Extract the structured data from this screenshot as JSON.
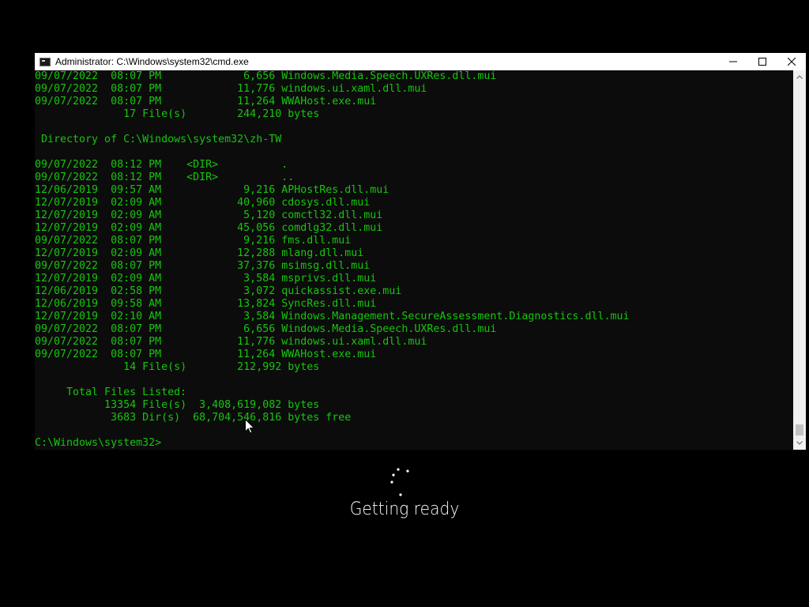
{
  "window": {
    "title": "Administrator: C:\\Windows\\system32\\cmd.exe",
    "controls": {
      "minimize": "minimize-icon",
      "maximize": "maximize-icon",
      "close": "close-icon"
    }
  },
  "console": {
    "lines": [
      "09/07/2022  08:07 PM             6,656 Windows.Media.Speech.UXRes.dll.mui",
      "09/07/2022  08:07 PM            11,776 windows.ui.xaml.dll.mui",
      "09/07/2022  08:07 PM            11,264 WWAHost.exe.mui",
      "              17 File(s)        244,210 bytes",
      "",
      " Directory of C:\\Windows\\system32\\zh-TW",
      "",
      "09/07/2022  08:12 PM    <DIR>          .",
      "09/07/2022  08:12 PM    <DIR>          ..",
      "12/06/2019  09:57 AM             9,216 APHostRes.dll.mui",
      "12/07/2019  02:09 AM            40,960 cdosys.dll.mui",
      "12/07/2019  02:09 AM             5,120 comctl32.dll.mui",
      "12/07/2019  02:09 AM            45,056 comdlg32.dll.mui",
      "09/07/2022  08:07 PM             9,216 fms.dll.mui",
      "12/07/2019  02:09 AM            12,288 mlang.dll.mui",
      "09/07/2022  08:07 PM            37,376 msimsg.dll.mui",
      "12/07/2019  02:09 AM             3,584 msprivs.dll.mui",
      "12/06/2019  02:58 PM             3,072 quickassist.exe.mui",
      "12/06/2019  09:58 AM            13,824 SyncRes.dll.mui",
      "12/07/2019  02:10 AM             3,584 Windows.Management.SecureAssessment.Diagnostics.dll.mui",
      "09/07/2022  08:07 PM             6,656 Windows.Media.Speech.UXRes.dll.mui",
      "09/07/2022  08:07 PM            11,776 windows.ui.xaml.dll.mui",
      "09/07/2022  08:07 PM            11,264 WWAHost.exe.mui",
      "              14 File(s)        212,992 bytes",
      "",
      "     Total Files Listed:",
      "           13354 File(s)  3,408,619,082 bytes",
      "            3683 Dir(s)  68,704,546,816 bytes free",
      "",
      "C:\\Windows\\system32>"
    ],
    "text_color": "#16c60c",
    "background": "#0c0c0c"
  },
  "overlay": {
    "status_text": "Getting ready",
    "spinner_icon": "loading-spinner-icon"
  }
}
